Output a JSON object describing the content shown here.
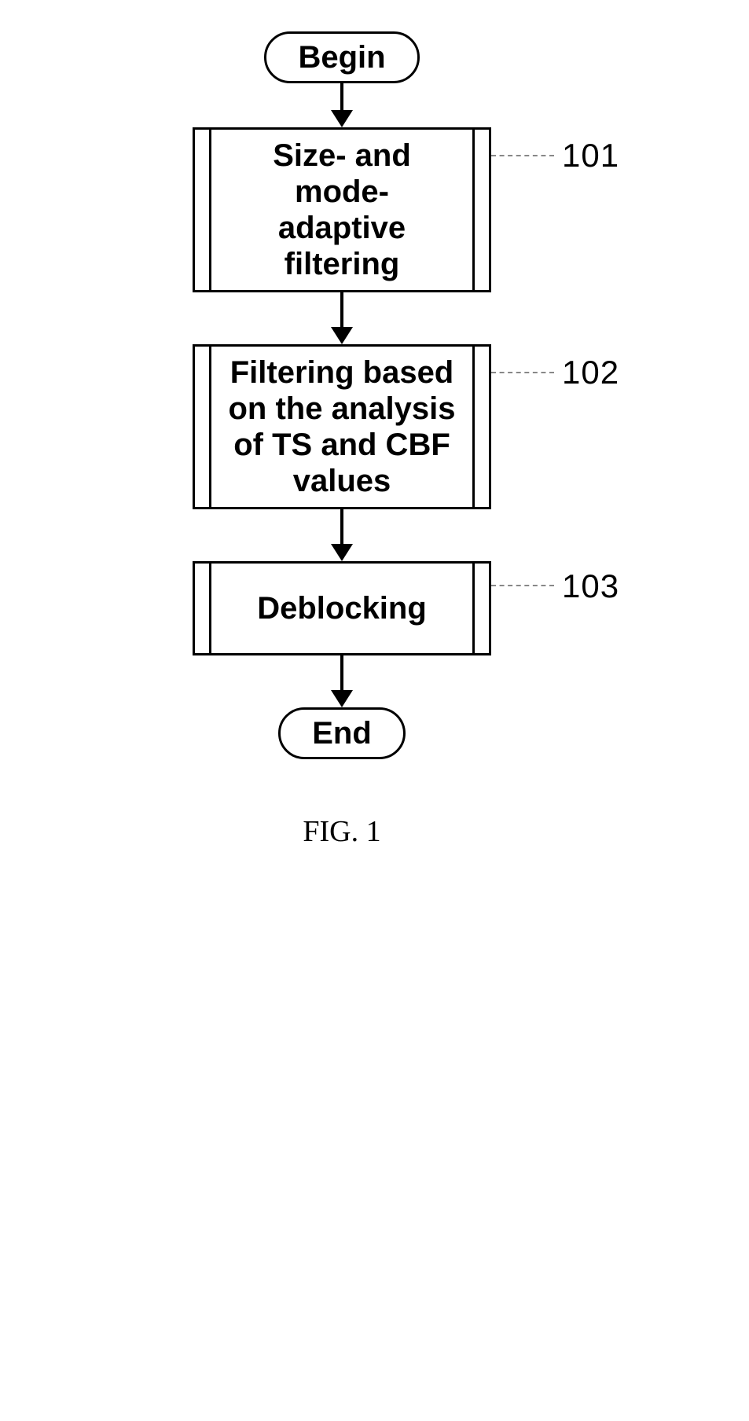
{
  "begin": "Begin",
  "end": "End",
  "steps": {
    "s1": {
      "text": "Size- and mode-\nadaptive filtering",
      "ref": "101"
    },
    "s2": {
      "text": "Filtering based\non the analysis\nof TS and CBF\nvalues",
      "ref": "102"
    },
    "s3": {
      "text": "Deblocking",
      "ref": "103"
    }
  },
  "caption": "FIG. 1"
}
